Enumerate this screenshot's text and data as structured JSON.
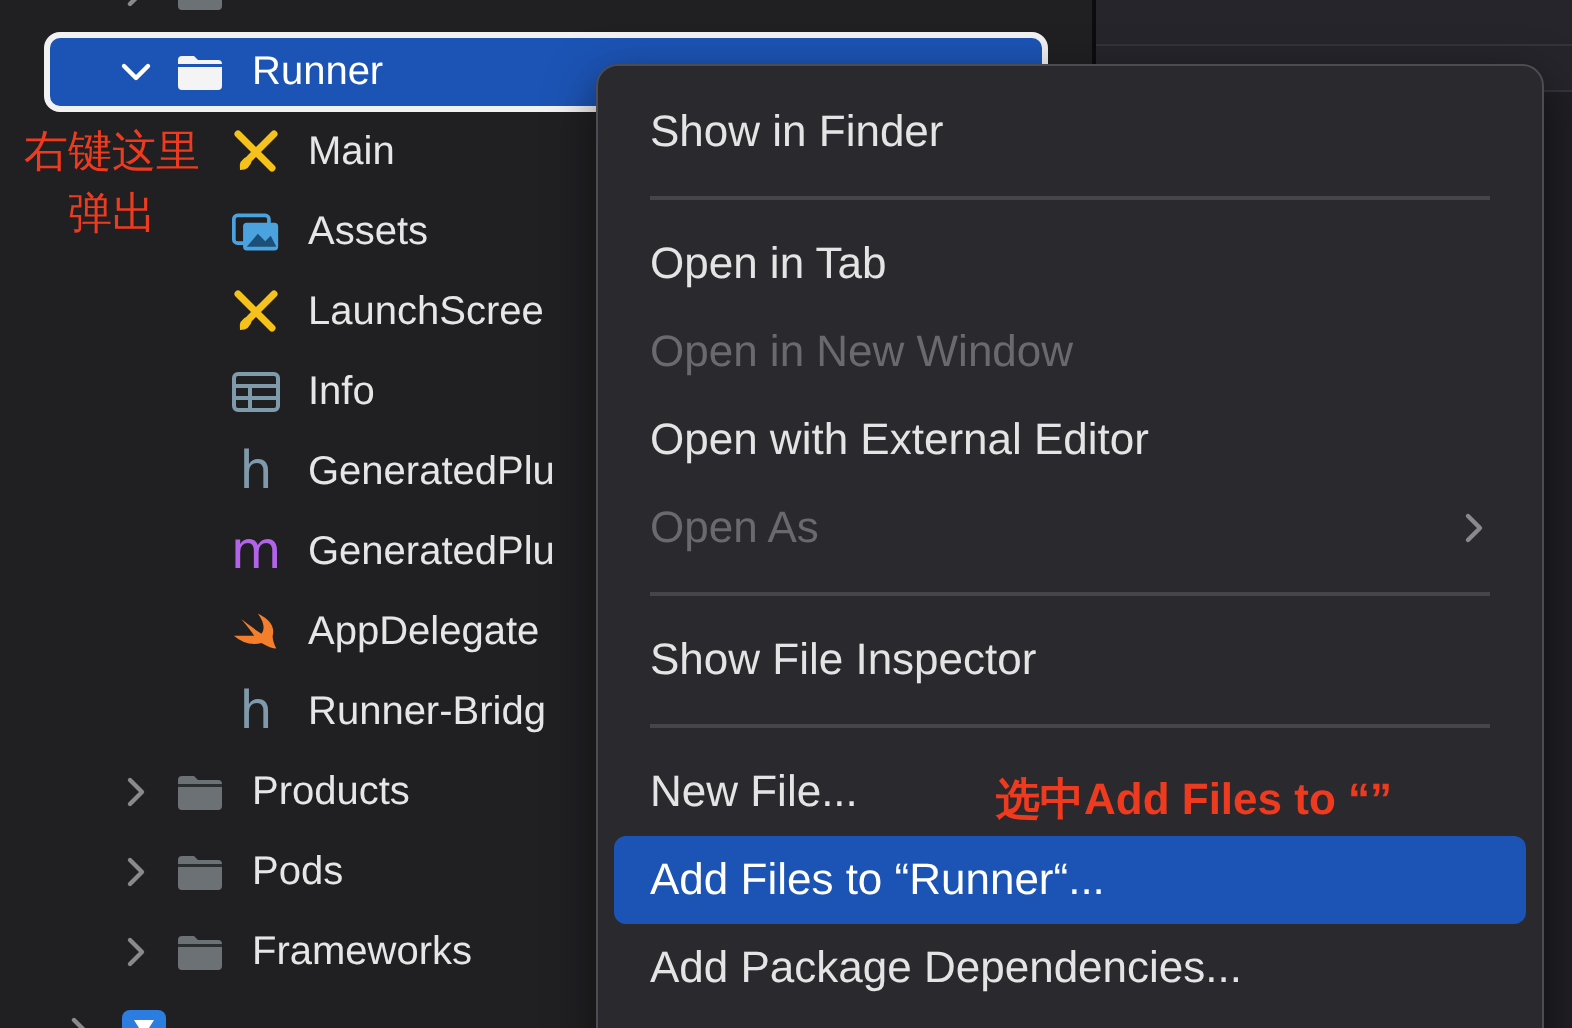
{
  "navigator": {
    "items": [
      {
        "kind": "folder",
        "expanded": false,
        "selected": false
      },
      {
        "label": "Runner",
        "kind": "folder",
        "expanded": true,
        "selected": true,
        "children": [
          {
            "label": "Main",
            "kind": "storyboard",
            "selected": false
          },
          {
            "label": "Assets",
            "kind": "assets",
            "selected": false
          },
          {
            "label": "LaunchScree",
            "kind": "storyboard",
            "selected": false
          },
          {
            "label": "Info",
            "kind": "plist",
            "selected": false
          },
          {
            "label": "GeneratedPlu",
            "kind": "header",
            "glyph": "h",
            "selected": false
          },
          {
            "label": "GeneratedPlu",
            "kind": "objc",
            "glyph": "m",
            "selected": false
          },
          {
            "label": "AppDelegate",
            "kind": "swift",
            "selected": false
          },
          {
            "label": "Runner-Bridg",
            "kind": "header",
            "glyph": "h",
            "selected": false
          }
        ]
      },
      {
        "label": "Products",
        "kind": "folder",
        "expanded": false,
        "selected": false
      },
      {
        "label": "Pods",
        "kind": "folder",
        "expanded": false,
        "selected": false
      },
      {
        "label": "Frameworks",
        "kind": "folder",
        "expanded": false,
        "selected": false
      }
    ],
    "root_items": [
      {
        "kind": "project",
        "expanded": false,
        "selected": false
      }
    ]
  },
  "context_menu": {
    "items": [
      {
        "kind": "item",
        "label": "Show in Finder",
        "disabled": false,
        "selected": false
      },
      {
        "kind": "separator"
      },
      {
        "kind": "item",
        "label": "Open in Tab",
        "disabled": false,
        "selected": false
      },
      {
        "kind": "item",
        "label": "Open in New Window",
        "disabled": true,
        "selected": false
      },
      {
        "kind": "item",
        "label": "Open with External Editor",
        "disabled": false,
        "selected": false
      },
      {
        "kind": "item",
        "label": "Open As",
        "disabled": true,
        "selected": false,
        "submenu": true
      },
      {
        "kind": "separator"
      },
      {
        "kind": "item",
        "label": "Show File Inspector",
        "disabled": false,
        "selected": false
      },
      {
        "kind": "separator"
      },
      {
        "kind": "item",
        "label": "New File...",
        "disabled": false,
        "selected": false
      },
      {
        "kind": "item",
        "label": "Add Files to “Runner“...",
        "disabled": false,
        "selected": true
      },
      {
        "kind": "item",
        "label": "Add Package Dependencies...",
        "disabled": false,
        "selected": false
      }
    ]
  },
  "annotations": [
    {
      "kind": "left",
      "text": "右键这里弹出"
    },
    {
      "kind": "menu",
      "text": "选中Add Files to “”"
    }
  ]
}
